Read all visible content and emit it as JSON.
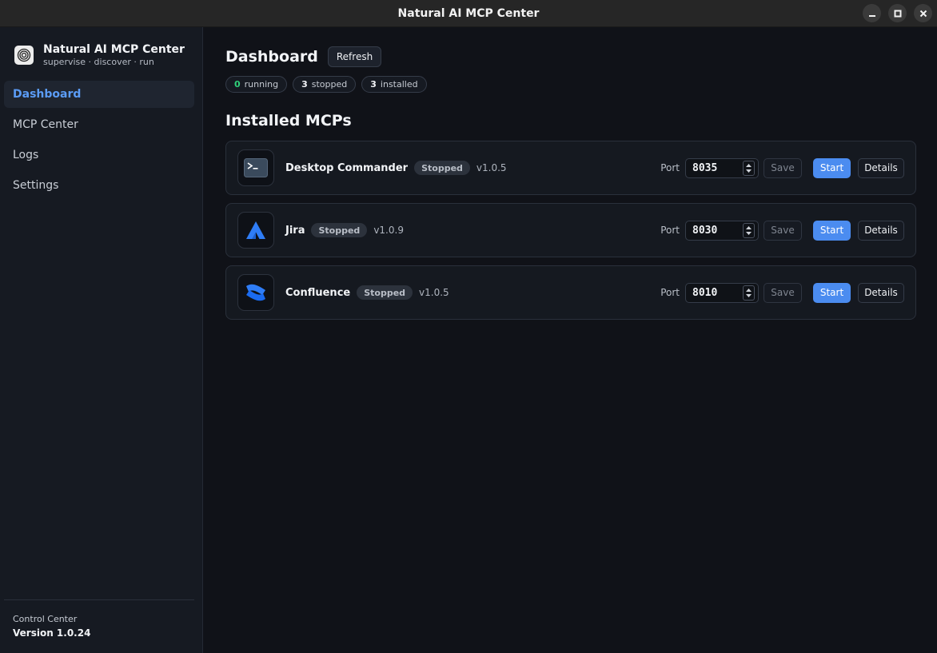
{
  "window": {
    "title": "Natural AI MCP Center",
    "controls": [
      "minimize-icon",
      "maximize-icon",
      "close-icon"
    ]
  },
  "sidebar": {
    "brand_title": "Natural AI MCP Center",
    "brand_subtitle": "supervise · discover · run",
    "items": [
      {
        "label": "Dashboard",
        "active": true
      },
      {
        "label": "MCP Center",
        "active": false
      },
      {
        "label": "Logs",
        "active": false
      },
      {
        "label": "Settings",
        "active": false
      }
    ],
    "footer_label": "Control Center",
    "footer_version": "Version 1.0.24"
  },
  "dashboard": {
    "title": "Dashboard",
    "refresh_label": "Refresh",
    "stats": {
      "running_count": "0",
      "running_label": "running",
      "stopped_count": "3",
      "stopped_label": "stopped",
      "installed_count": "3",
      "installed_label": "installed"
    },
    "section_title": "Installed MCPs",
    "port_label": "Port",
    "save_label": "Save",
    "start_label": "Start",
    "details_label": "Details",
    "mcps": [
      {
        "name": "Desktop Commander",
        "status": "Stopped",
        "version": "v1.0.5",
        "port": "8035",
        "icon": "terminal-icon"
      },
      {
        "name": "Jira",
        "status": "Stopped",
        "version": "v1.0.9",
        "port": "8030",
        "icon": "jira-logo-icon"
      },
      {
        "name": "Confluence",
        "status": "Stopped",
        "version": "v1.0.5",
        "port": "8010",
        "icon": "confluence-logo-icon"
      }
    ]
  },
  "colors": {
    "accent": "#4b8cf0",
    "active_nav": "#5b9cf6",
    "running": "#2fd07a",
    "background": "#101218"
  }
}
